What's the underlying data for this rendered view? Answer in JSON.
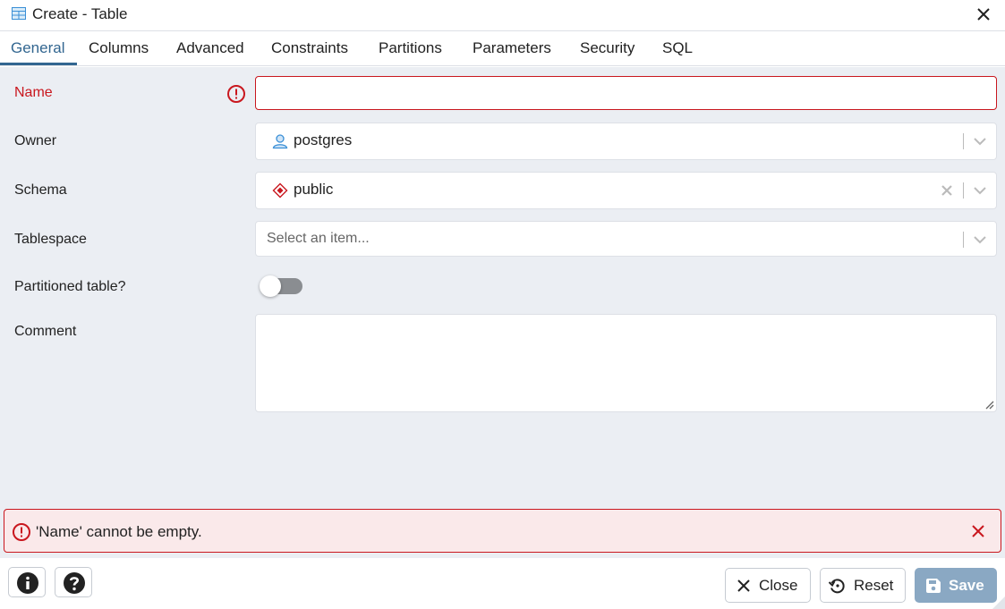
{
  "window": {
    "title": "Create - Table",
    "icon": "table-icon",
    "close_icon": "close-icon"
  },
  "tabs": [
    {
      "label": "General",
      "active": true
    },
    {
      "label": "Columns",
      "active": false
    },
    {
      "label": "Advanced",
      "active": false
    },
    {
      "label": "Constraints",
      "active": false
    },
    {
      "label": "Partitions",
      "active": false
    },
    {
      "label": "Parameters",
      "active": false
    },
    {
      "label": "Security",
      "active": false
    },
    {
      "label": "SQL",
      "active": false
    }
  ],
  "form": {
    "name": {
      "label": "Name",
      "value": "",
      "invalid": true,
      "icon": "error-circle-icon"
    },
    "owner": {
      "label": "Owner",
      "value": "postgres",
      "icon": "user-icon"
    },
    "schema": {
      "label": "Schema",
      "value": "public",
      "icon": "schema-icon"
    },
    "tablespace": {
      "label": "Tablespace",
      "placeholder": "Select an item..."
    },
    "partitioned": {
      "label": "Partitioned table?",
      "checked": false
    },
    "comment": {
      "label": "Comment",
      "value": ""
    }
  },
  "alert": {
    "message": "'Name' cannot be empty.",
    "icon": "error-circle-icon",
    "close_icon": "close-icon"
  },
  "footer": {
    "info_icon": "info-icon",
    "help_icon": "help-icon",
    "close_label": "Close",
    "reset_label": "Reset",
    "save_label": "Save"
  },
  "colors": {
    "accent": "#326690",
    "error": "#c9171e",
    "error_bg": "#fae9ea",
    "body_bg": "#ebeef3",
    "save_disabled": "#8aa8c3"
  }
}
